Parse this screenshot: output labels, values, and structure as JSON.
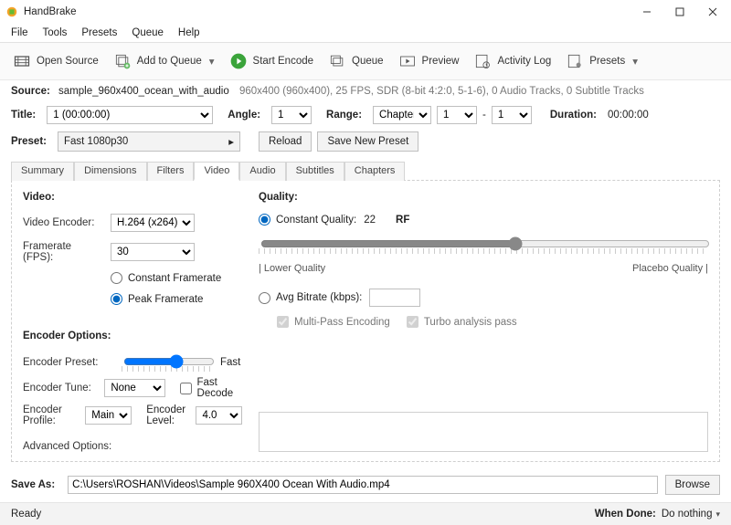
{
  "window": {
    "title": "HandBrake"
  },
  "menu": [
    "File",
    "Tools",
    "Presets",
    "Queue",
    "Help"
  ],
  "toolbar": {
    "open": "Open Source",
    "addqueue": "Add to Queue",
    "start": "Start Encode",
    "queue": "Queue",
    "preview": "Preview",
    "activity": "Activity Log",
    "presets": "Presets"
  },
  "source": {
    "label": "Source:",
    "name": "sample_960x400_ocean_with_audio",
    "info": "960x400 (960x400), 25 FPS, SDR (8-bit 4:2:0, 5-1-6), 0 Audio Tracks, 0 Subtitle Tracks"
  },
  "titlebar_row": {
    "title_label": "Title:",
    "title_value": "1  (00:00:00)",
    "angle_label": "Angle:",
    "angle_value": "1",
    "range_label": "Range:",
    "range_type": "Chapters",
    "range_from": "1",
    "dash": "-",
    "range_to": "1",
    "duration_label": "Duration:",
    "duration_value": "00:00:00"
  },
  "preset_row": {
    "label": "Preset:",
    "value": "Fast 1080p30",
    "reload": "Reload",
    "savenew": "Save New Preset"
  },
  "tabs": [
    "Summary",
    "Dimensions",
    "Filters",
    "Video",
    "Audio",
    "Subtitles",
    "Chapters"
  ],
  "active_tab": "Video",
  "video": {
    "video_header": "Video:",
    "encoder_label": "Video Encoder:",
    "encoder_value": "H.264 (x264)",
    "fps_label": "Framerate (FPS):",
    "fps_value": "30",
    "const_fr": "Constant Framerate",
    "peak_fr": "Peak Framerate",
    "quality_header": "Quality:",
    "cq_label": "Constant Quality:",
    "cq_value": "22",
    "cq_unit": "RF",
    "lower": "| Lower Quality",
    "placebo": "Placebo Quality |",
    "avg_label": "Avg Bitrate (kbps):",
    "multipass": "Multi-Pass Encoding",
    "turbo": "Turbo analysis pass",
    "enc_opts_header": "Encoder Options:",
    "enc_preset_label": "Encoder Preset:",
    "enc_preset_value": "Fast",
    "enc_tune_label": "Encoder Tune:",
    "enc_tune_value": "None",
    "fast_decode": "Fast Decode",
    "enc_profile_label": "Encoder Profile:",
    "enc_profile_value": "Main",
    "enc_level_label": "Encoder Level:",
    "enc_level_value": "4.0",
    "adv_label": "Advanced Options:"
  },
  "save": {
    "label": "Save As:",
    "path": "C:\\Users\\ROSHAN\\Videos\\Sample 960X400 Ocean With Audio.mp4",
    "browse": "Browse"
  },
  "status": {
    "ready": "Ready",
    "when_done_label": "When Done:",
    "when_done_value": "Do nothing"
  }
}
